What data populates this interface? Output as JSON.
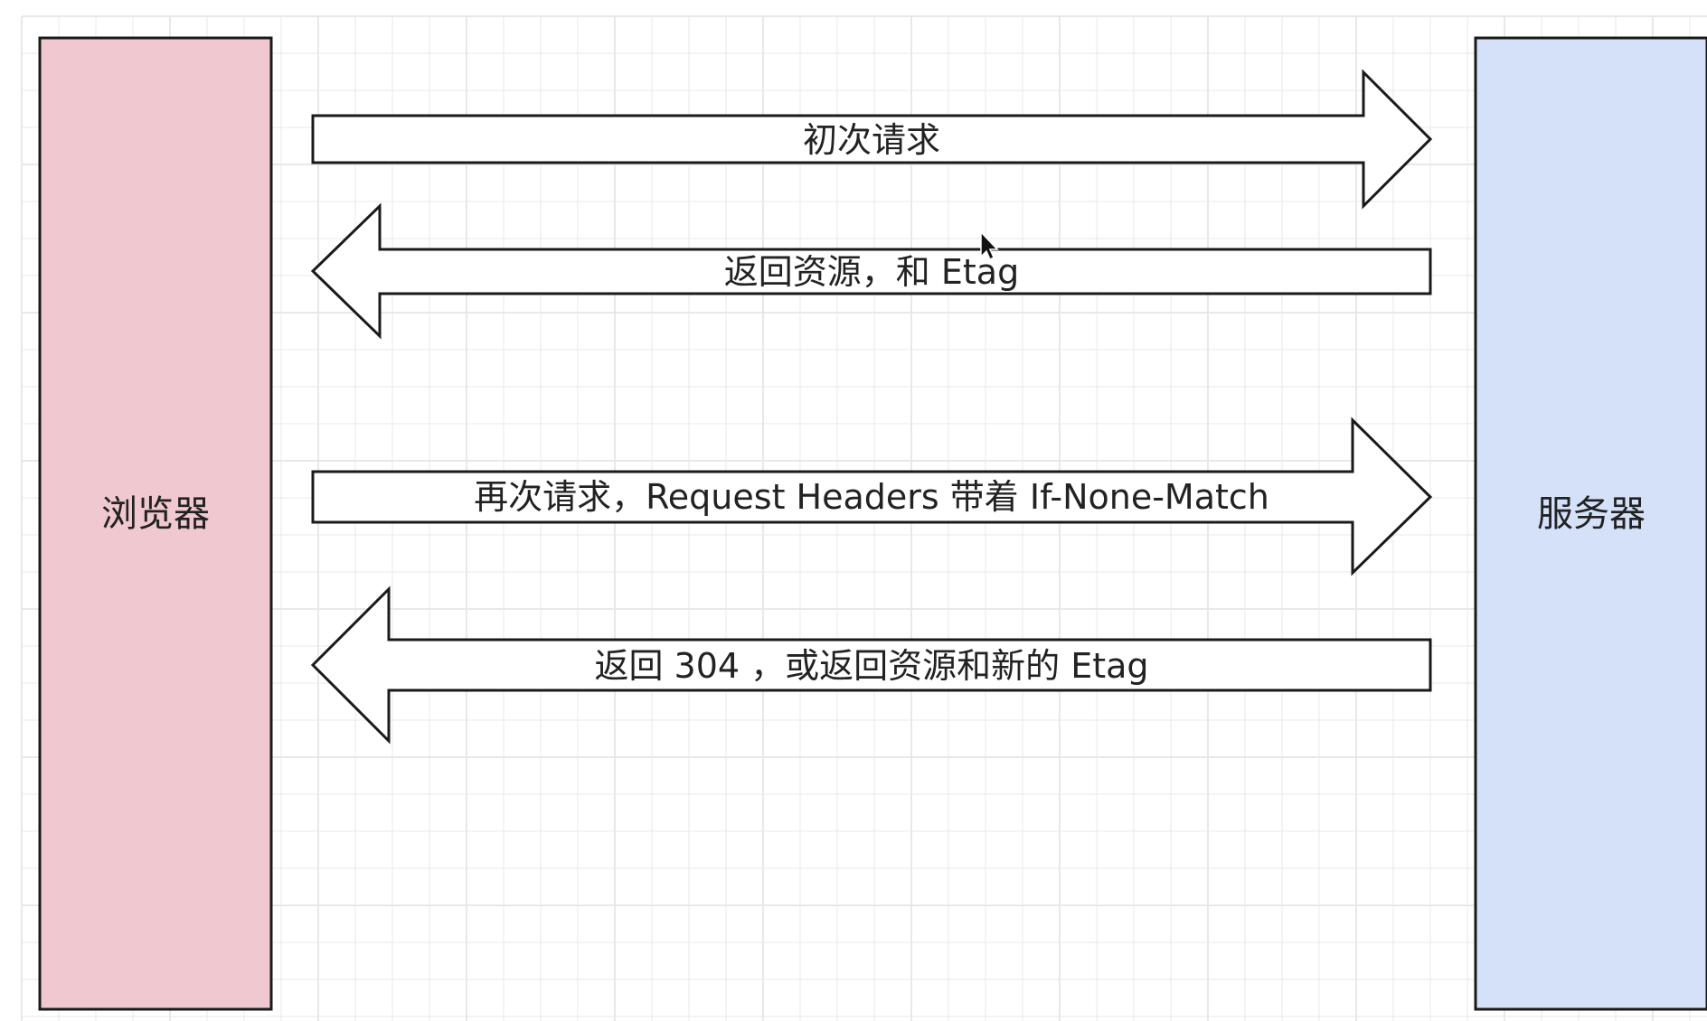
{
  "nodes": {
    "browser": {
      "label": "浏览器",
      "fill": "#f0c8cf"
    },
    "server": {
      "label": "服务器",
      "fill": "#d4e1f9"
    }
  },
  "arrows": [
    {
      "direction": "right",
      "label": "初次请求"
    },
    {
      "direction": "left",
      "label": "返回资源，和 Etag"
    },
    {
      "direction": "right",
      "label": "再次请求，Request Headers 带着 If-None-Match"
    },
    {
      "direction": "left",
      "label": "返回 304 ，或返回资源和新的 Etag"
    }
  ],
  "style": {
    "grid_color": "#e8e8e8",
    "stroke_color": "#1a1a1a",
    "arrow_fill": "#ffffff"
  }
}
